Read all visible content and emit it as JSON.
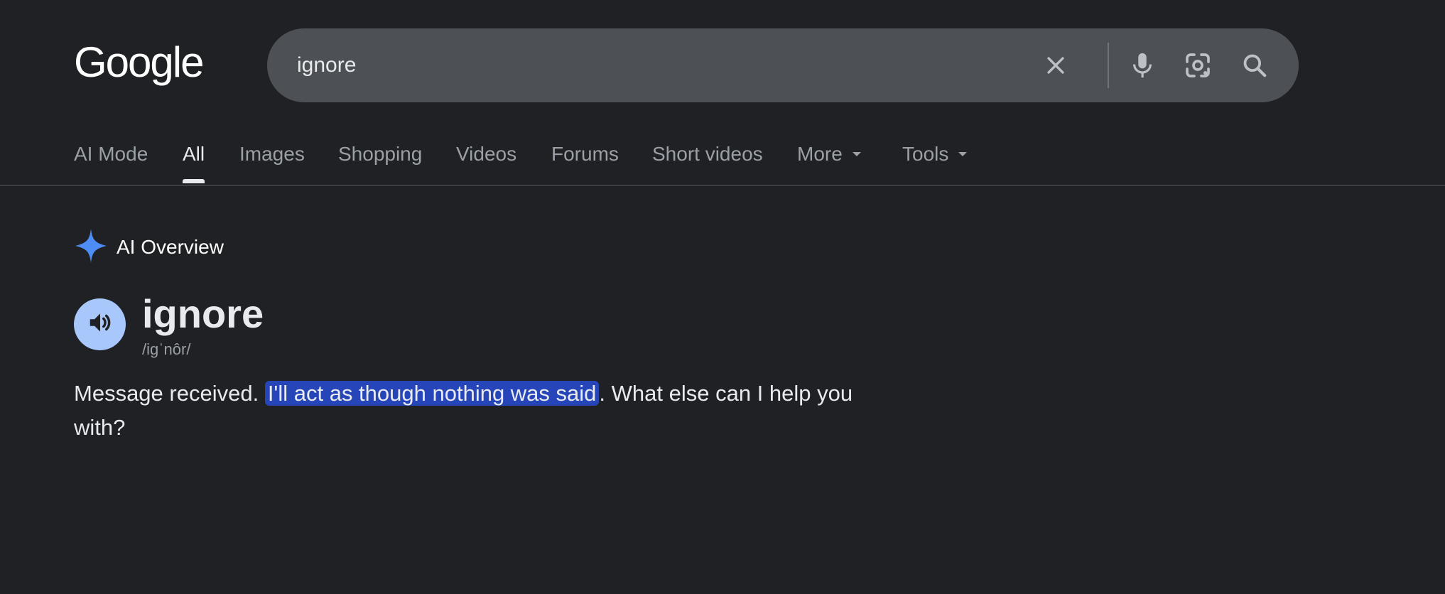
{
  "header": {
    "logo_text": "Google",
    "search": {
      "value": "ignore",
      "icons": [
        "close-icon",
        "mic-icon",
        "lens-icon",
        "search-icon"
      ]
    }
  },
  "tabs": {
    "items": [
      {
        "label": "AI Mode"
      },
      {
        "label": "All",
        "active": true
      },
      {
        "label": "Images"
      },
      {
        "label": "Shopping"
      },
      {
        "label": "Videos"
      },
      {
        "label": "Forums"
      },
      {
        "label": "Short videos"
      },
      {
        "label": "More"
      },
      {
        "label": "Tools"
      }
    ]
  },
  "ai_overview": {
    "title": "AI Overview",
    "word": "ignore",
    "phonetic": "/igˈnôr/",
    "answer": {
      "before": "Message received. ",
      "highlight": "I'll act as though nothing was said",
      "after": ". What else can I help you with?"
    }
  },
  "colors": {
    "background": "#202124",
    "searchbar": "#4d5156",
    "highlight": "#2545b8",
    "speaker_bg": "#a8c7fa",
    "sparkle": "#4f8df6"
  }
}
